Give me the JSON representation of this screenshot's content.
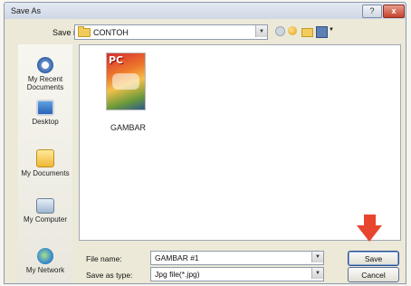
{
  "window": {
    "title": "Save As",
    "help_glyph": "?",
    "close_glyph": "x"
  },
  "save_in": {
    "label": "Save in:",
    "value": "CONTOH"
  },
  "places": [
    {
      "label": "My Recent Documents",
      "icon": "recent-documents-icon"
    },
    {
      "label": "Desktop",
      "icon": "desktop-icon"
    },
    {
      "label": "My Documents",
      "icon": "my-documents-icon"
    },
    {
      "label": "My Computer",
      "icon": "my-computer-icon"
    },
    {
      "label": "My Network",
      "icon": "my-network-icon"
    }
  ],
  "files": [
    {
      "name": "GAMBAR",
      "thumb_text": "PC"
    }
  ],
  "file_name": {
    "label": "File name:",
    "value": "GAMBAR #1"
  },
  "save_as_type": {
    "label": "Save as type:",
    "value": "Jpg file(*.jpg)"
  },
  "buttons": {
    "save": "Save",
    "cancel": "Cancel"
  },
  "colors": {
    "highlight_arrow": "#e8452f",
    "dialog_bg": "#ece9d8"
  }
}
